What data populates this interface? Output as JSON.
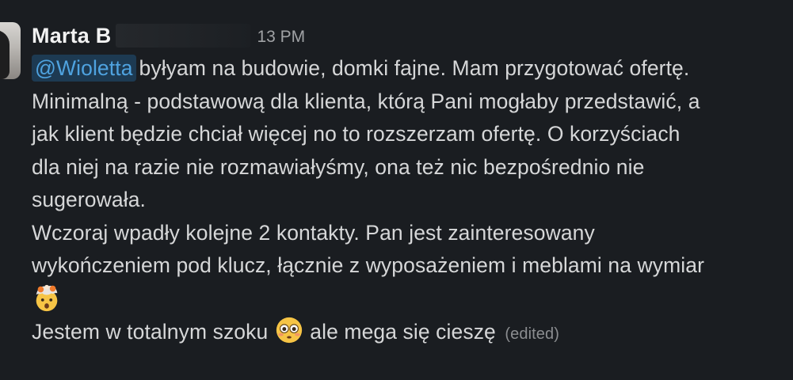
{
  "message": {
    "sender": "Marta B",
    "time": "13 PM",
    "mention": "@Wioletta",
    "lines": [
      "byłyam na budowie, domki fajne. Mam przygotować ofertę.",
      "Minimalną - podstawową dla klienta, którą Pani mogłaby przedstawić, a",
      "jak klient będzie chciał więcej no to rozszerzam ofertę. O korzyściach",
      "dla niej na razie nie rozmawiałyśmy, ona też nic bezpośrednio nie",
      "sugerowała.",
      "Wczoraj wpadły kolejne 2 kontakty. Pan jest zainteresowany",
      "wykończeniem pod klucz, łącznie z wyposażeniem i meblami na wymiar"
    ],
    "last_line_before": "Jestem w totalnym szoku",
    "last_line_after": "ale mega się cieszę",
    "edited_label": "(edited)",
    "emojis": [
      "exploding-head-icon",
      "flushed-face-icon"
    ]
  }
}
